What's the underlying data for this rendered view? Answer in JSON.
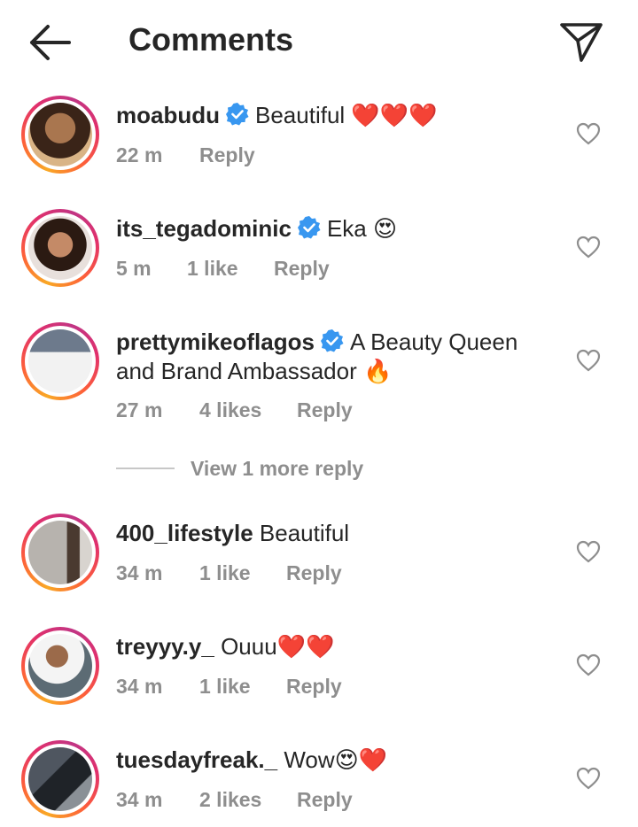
{
  "header": {
    "title": "Comments",
    "back_icon": "arrow-left-icon",
    "share_icon": "paper-plane-icon"
  },
  "comments": [
    {
      "username": "moabudu",
      "verified": true,
      "text": "Beautiful ❤️❤️❤️",
      "time": "22 m",
      "likes": "",
      "reply": "Reply"
    },
    {
      "username": "its_tegadominic",
      "verified": true,
      "text": "Eka 😍",
      "time": "5 m",
      "likes": "1 like",
      "reply": "Reply"
    },
    {
      "username": "prettymikeoflagos",
      "verified": true,
      "text": "A Beauty Queen",
      "text2": "and Brand Ambassador 🔥",
      "time": "27 m",
      "likes": "4 likes",
      "reply": "Reply"
    },
    {
      "username": "400_lifestyle",
      "verified": false,
      "text": "Beautiful",
      "time": "34 m",
      "likes": "1 like",
      "reply": "Reply"
    },
    {
      "username": "treyyy.y_",
      "verified": false,
      "text": "Ouuu❤️❤️",
      "time": "34 m",
      "likes": "1 like",
      "reply": "Reply"
    },
    {
      "username": "tuesdayfreak._",
      "verified": false,
      "text": "Wow😍❤️",
      "time": "34 m",
      "likes": "2 likes",
      "reply": "Reply"
    }
  ],
  "view_more": "View 1 more reply",
  "colors": {
    "verified_blue": "#3897f0",
    "muted": "#8e8e8e",
    "text": "#262626"
  }
}
